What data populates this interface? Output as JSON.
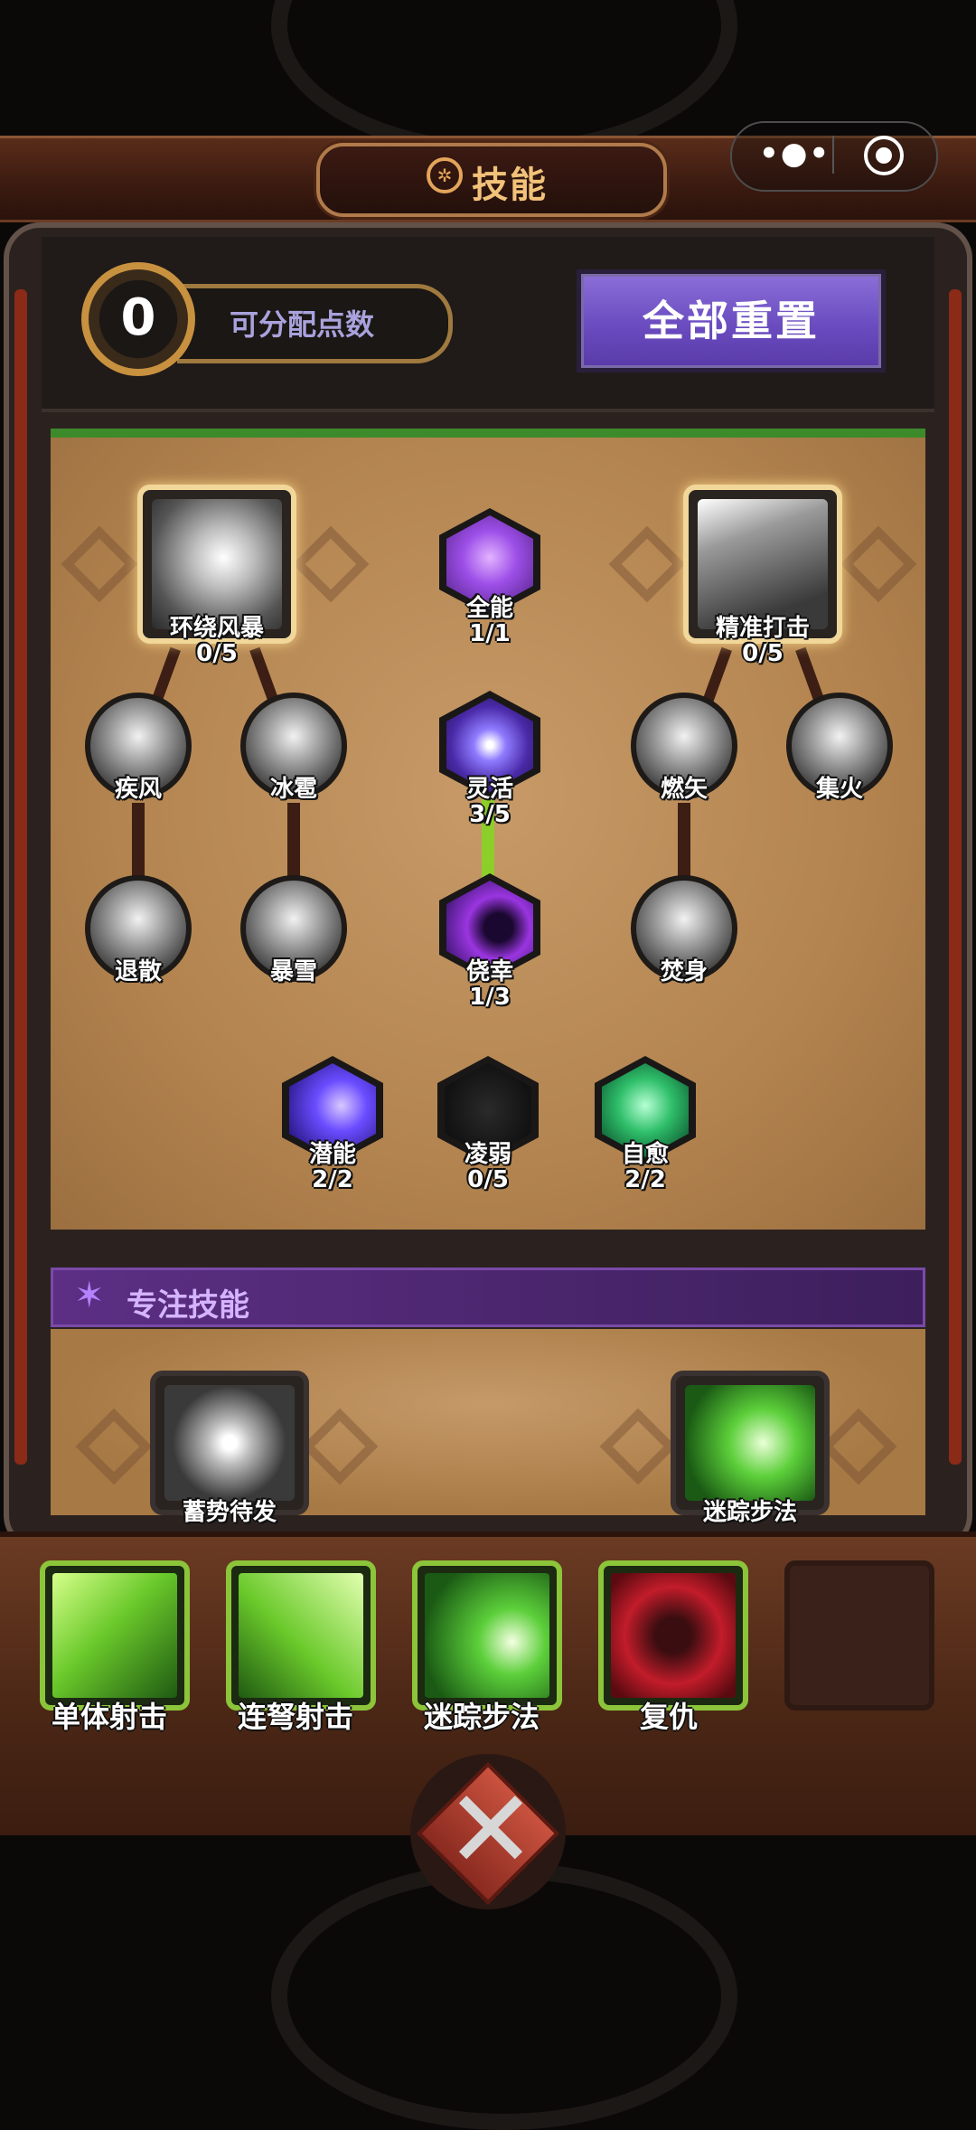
{
  "header": {
    "title": "技能",
    "title_icon": "gear-emblem-icon",
    "capsule_more_icon": "more-dots-icon",
    "capsule_close_icon": "target-circle-icon"
  },
  "points": {
    "value": "0",
    "label": "可分配点数"
  },
  "reset_button": "全部重置",
  "tree": {
    "tornado": {
      "name": "环绕风暴",
      "level": "0/5"
    },
    "precision": {
      "name": "精准打击",
      "level": "0/5"
    },
    "omni": {
      "name": "全能",
      "level": "1/1"
    },
    "agile": {
      "name": "灵活",
      "level": "3/5"
    },
    "lucky": {
      "name": "侥幸",
      "level": "1/3"
    },
    "gale": {
      "name": "疾风"
    },
    "hail": {
      "name": "冰雹"
    },
    "burn_arrow": {
      "name": "燃矢"
    },
    "focus_fire": {
      "name": "集火"
    },
    "disperse": {
      "name": "退散"
    },
    "blizzard": {
      "name": "暴雪"
    },
    "self_burn": {
      "name": "焚身"
    },
    "potential": {
      "name": "潜能",
      "level": "2/2"
    },
    "weaken": {
      "name": "凌弱",
      "level": "0/5"
    },
    "heal": {
      "name": "自愈",
      "level": "2/2"
    }
  },
  "focus": {
    "title": "专注技能",
    "skills": [
      "蓄势待发",
      "迷踪步法"
    ]
  },
  "equipped": [
    {
      "name": "单体射击",
      "color": "#7ad12f"
    },
    {
      "name": "连弩射击",
      "color": "#7ad12f"
    },
    {
      "name": "迷踪步法",
      "color": "#53c53a"
    },
    {
      "name": "复仇",
      "color": "#c21c2a"
    }
  ],
  "colors": {
    "accent_purple": "#6a4cc0",
    "tree_border_green": "#3d8a2a",
    "slot_border_green": "#8cc43a",
    "title_gold": "#f2c27a"
  }
}
